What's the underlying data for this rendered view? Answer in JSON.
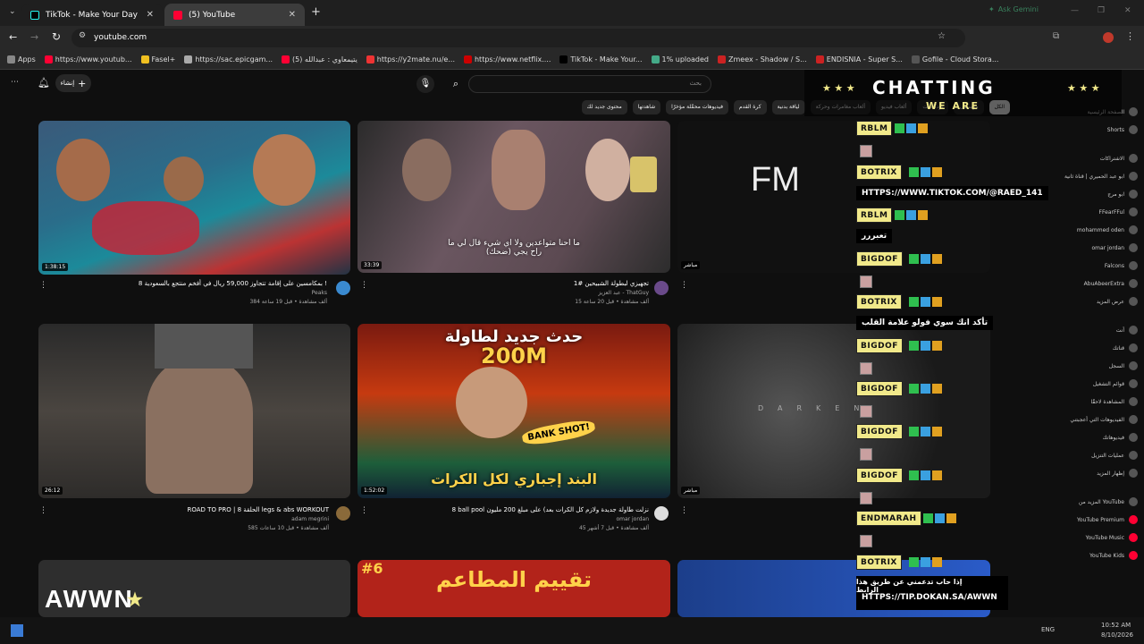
{
  "browser": {
    "tabs": [
      {
        "title": "TikTok - Make Your Day",
        "close": "✕"
      },
      {
        "title": "(5) YouTube",
        "close": "✕"
      }
    ],
    "new_tab": "+",
    "url": "youtube.com",
    "gemini": "Ask Gemini"
  },
  "bookmarks": [
    "Apps",
    "https://www.youtub...",
    "Fasel+",
    "https://sac.epicgam...",
    "يتيمعاوي : عبدالله (5)",
    "https://y2mate.nu/e...",
    "https://www.netflix....",
    "TikTok - Make Your...",
    "1% uploaded",
    "Zmeex - Shadow / S...",
    "ENDISNIA - Super S...",
    "Gofile - Cloud Stora..."
  ],
  "youtube": {
    "create": "إنشاء",
    "search_placeholder": "بحث",
    "chips": [
      "الكل",
      "موسيقى",
      "بودكاست",
      "ألعاب فيديو",
      "ألعاب مغامرات وحركة",
      "لياقة بدنية",
      "كرة القدم",
      "فيديوهات محمَّلة مؤخرًا",
      "شاهدتها",
      "محتوى جديد لك"
    ],
    "videos": [
      {
        "title": "8 بمكامسين على إقامة تتجاوز 59,000 ريال في أفخم منتجع بالسعودية !",
        "channel": "Peaks",
        "stats": "384 ألف مشاهدة • قبل 19 ساعة",
        "dur": "1:38:15"
      },
      {
        "title": "تجهيزي لبطولة الشبيحين #1",
        "channel": "عبد العزيز - ThatGuy",
        "stats": "15 ألف مشاهدة • قبل 20 ساعة",
        "dur": "33:39"
      },
      {
        "title": "",
        "channel": "",
        "stats": "",
        "dur": "مباشر"
      },
      {
        "title": "ROAD TO PRO | الحلقة 8 legs & abs WORKOUT",
        "channel": "adam megrini",
        "stats": "585 ألف مشاهدة • قبل 10 ساعات",
        "dur": "26:12"
      },
      {
        "title": "8 ball pool نزلت طاولة جديدة ولازم كل الكرات بعد) على مبلغ 200 مليون",
        "channel": "omar jordan",
        "stats": "45 ألف مشاهدة • قبل 7 أشهر",
        "dur": "1:52:02"
      },
      {
        "title": "",
        "channel": "",
        "stats": "",
        "dur": "مباشر"
      }
    ],
    "thumb_text": {
      "v1_sub": "ما احنا متواعدين ولا اي شيء قال لي ما راح يجي (ضحك)",
      "v3": "FM",
      "v5_top": "حدث جديد لطاولة",
      "v5_num": "200M",
      "v5_bank": "BANK SHOT!",
      "v5_bottom": "البند إجباري لكل الكرات",
      "v6_logo": "DARKEN",
      "v8": "تقييم المطاعم",
      "v8_num": "#6"
    },
    "sidebar": [
      "الصفحة الرئيسية",
      "Shorts",
      "الاشتراكات",
      "ابو عبد الحميري | قناة ثانية",
      "ابو مرج",
      "FFearFFul",
      "mohammed oden",
      "omar jordan",
      "Falcons",
      "AbuAbeerExtra",
      "عرض المزيد",
      "أنت",
      "قناتك",
      "السجل",
      "قوائم التشغيل",
      "المشاهدة لاحقًا",
      "الفيديوهات التي أعجبتني",
      "فيديوهاتك",
      "عمليات التنزيل",
      "إظهار المزيد",
      "المزيد من YouTube",
      "YouTube Premium",
      "YouTube Music",
      "YouTube Kids"
    ]
  },
  "overlay": {
    "title": "CHATTING",
    "subtitle": "WE ARE",
    "logo": "AWWN",
    "logo_star": "★",
    "chat": [
      {
        "user": "RBLM",
        "text": ""
      },
      {
        "user": "BOTRIX",
        "text": "HTTPS://WWW.TIKTOK.COM/@RAED_141"
      },
      {
        "user": "RBLM",
        "text": "تعبررر"
      },
      {
        "user": "BIGDOF",
        "text": ""
      },
      {
        "user": "BOTRIX",
        "text": "تأكد انك سوي فولو علامة القلب"
      },
      {
        "user": "BIGDOF",
        "text": ""
      },
      {
        "user": "BIGDOF",
        "text": ""
      },
      {
        "user": "BIGDOF",
        "text": ""
      },
      {
        "user": "BIGDOF",
        "text": ""
      },
      {
        "user": "ENDMARAH",
        "text": ""
      },
      {
        "user": "BOTRIX",
        "text": "إذا حاب تدعمني عن طريق هذا الرابط"
      }
    ],
    "tip_url": "HTTPS://TIP.DOKAN.SA/AWWN"
  },
  "taskbar": {
    "lang": "ENG",
    "time": "10:52 AM",
    "date": "8/10/2026"
  },
  "colors": {
    "yt_red": "#ff0033",
    "badge": "#f1e98a"
  }
}
